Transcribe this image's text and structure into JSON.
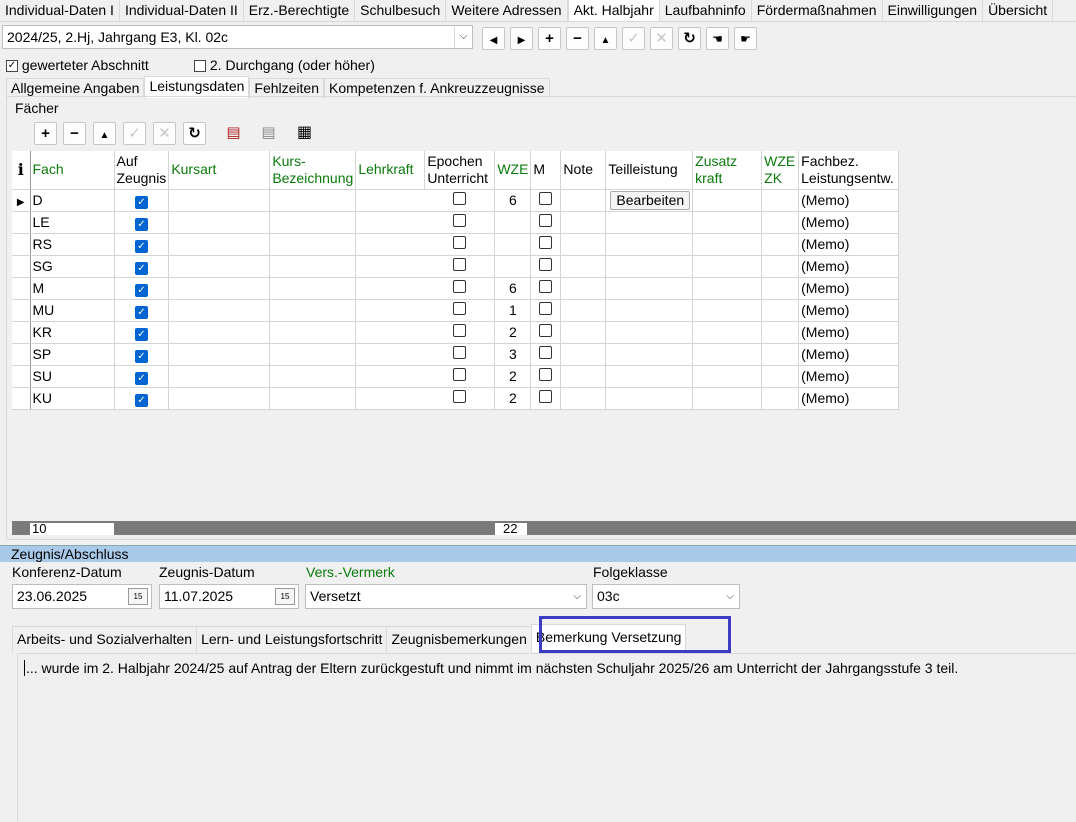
{
  "top_tabs": [
    "Individual-Daten I",
    "Individual-Daten II",
    "Erz.-Berechtigte",
    "Schulbesuch",
    "Weitere Adressen",
    "Akt. Halbjahr",
    "Laufbahninfo",
    "Fördermaßnahmen",
    "Einwilligungen",
    "Übersicht"
  ],
  "active_top_tab": 5,
  "period_select": {
    "value": "2024/25, 2.Hj, Jahrgang E3, Kl. 02c"
  },
  "checkboxes": {
    "gewerteter_label": "gewerteter Abschnitt",
    "gewerteter_checked": true,
    "durchgang_label": "2. Durchgang (oder höher)",
    "durchgang_checked": false
  },
  "sub_tabs": [
    "Allgemeine Angaben",
    "Leistungsdaten",
    "Fehlzeiten",
    "Kompetenzen f. Ankreuzzeugnisse"
  ],
  "active_sub_tab": 1,
  "faecher_group_label": "Fächer",
  "grid": {
    "info_label": "i",
    "columns": {
      "fach": "Fach",
      "auf_zeugnis_1": "Auf",
      "auf_zeugnis_2": "Zeugnis",
      "kursart": "Kursart",
      "kurs_bez_1": "Kurs-",
      "kurs_bez_2": "Bezeichnung",
      "lehrkraft": "Lehrkraft",
      "epochen_1": "Epochen",
      "epochen_2": "Unterricht",
      "wze": "WZE",
      "m": "M",
      "note": "Note",
      "teilleistung": "Teilleistung",
      "zusatz_1": "Zusatz",
      "zusatz_2": "kraft",
      "wzezk_1": "WZE",
      "wzezk_2": "ZK",
      "fachbez_1": "Fachbez.",
      "fachbez_2": "Leistungsentw."
    },
    "bearbeiten_label": "Bearbeiten",
    "rows": [
      {
        "fach": "D",
        "wze": "6",
        "memo": "(Memo)"
      },
      {
        "fach": "LE",
        "wze": "",
        "memo": "(Memo)"
      },
      {
        "fach": "RS",
        "wze": "",
        "memo": "(Memo)"
      },
      {
        "fach": "SG",
        "wze": "",
        "memo": "(Memo)"
      },
      {
        "fach": "M",
        "wze": "6",
        "memo": "(Memo)"
      },
      {
        "fach": "MU",
        "wze": "1",
        "memo": "(Memo)"
      },
      {
        "fach": "KR",
        "wze": "2",
        "memo": "(Memo)"
      },
      {
        "fach": "SP",
        "wze": "3",
        "memo": "(Memo)"
      },
      {
        "fach": "SU",
        "wze": "2",
        "memo": "(Memo)"
      },
      {
        "fach": "KU",
        "wze": "2",
        "memo": "(Memo)"
      }
    ],
    "footer_count": "10",
    "footer_wze_sum": "22"
  },
  "zeugnis": {
    "section_title": "Zeugnis/Abschluss",
    "konferenz_label": "Konferenz-Datum",
    "konferenz_value": "23.06.2025",
    "zeugnis_label": "Zeugnis-Datum",
    "zeugnis_value": "11.07.2025",
    "vermerk_label": "Vers.-Vermerk",
    "vermerk_value": "Versetzt",
    "folgeklasse_label": "Folgeklasse",
    "folgeklasse_value": "03c"
  },
  "bottom_tabs": [
    "Arbeits- und Sozialverhalten",
    "Lern- und Leistungsfortschritt",
    "Zeugnisbemerkungen",
    "Bemerkung Versetzung"
  ],
  "active_bottom_tab": 3,
  "bemerkung_text": "... wurde im 2. Halbjahr 2024/25 auf Antrag der Eltern zurückgestuft und nimmt im nächsten Schuljahr 2025/26 am Unterricht der Jahrgangsstufe 3 teil."
}
